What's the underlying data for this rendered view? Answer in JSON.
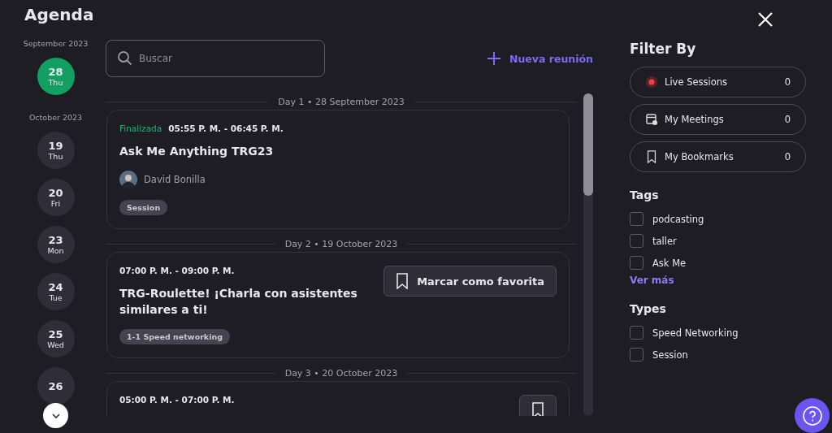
{
  "title": "Agenda",
  "dates": [
    {
      "month": "September 2023",
      "days": [
        {
          "num": "28",
          "dow": "Thu",
          "selected": true
        }
      ]
    },
    {
      "month": "October 2023",
      "days": [
        {
          "num": "19",
          "dow": "Thu",
          "selected": false
        },
        {
          "num": "20",
          "dow": "Fri",
          "selected": false
        },
        {
          "num": "23",
          "dow": "Mon",
          "selected": false
        },
        {
          "num": "24",
          "dow": "Tue",
          "selected": false
        },
        {
          "num": "25",
          "dow": "Wed",
          "selected": false
        },
        {
          "num": "26",
          "selected": false
        }
      ]
    }
  ],
  "search": {
    "placeholder": "Buscar"
  },
  "new_meeting": {
    "label": "Nueva reunión"
  },
  "days": [
    {
      "label": "Day 1 • 28 September 2023",
      "sessions": [
        {
          "status": "Finalizada",
          "time": "05:55 P. M. - 06:45 P. M.",
          "title": "Ask Me Anything TRG23",
          "speaker": "David Bonilla",
          "tag": "Session",
          "bookmark": false
        }
      ]
    },
    {
      "label": "Day 2 • 19 October 2023",
      "sessions": [
        {
          "time": "07:00 P. M. - 09:00 P. M.",
          "title": "TRG-Roulette! ¡Charla con asistentes similares a ti!",
          "tag": "1-1 Speed networking",
          "bookmark": true,
          "bookmark_label": "Marcar como favorita"
        }
      ]
    },
    {
      "label": "Day 3 • 20 October 2023",
      "sessions": [
        {
          "time": "05:00 P. M. - 07:00 P. M.",
          "bookmark": true
        }
      ]
    }
  ],
  "filter": {
    "title": "Filter By",
    "items": [
      {
        "kind": "live",
        "label": "Live Sessions",
        "count": "0"
      },
      {
        "kind": "meetings",
        "label": "My Meetings",
        "count": "0"
      },
      {
        "kind": "bookmarks",
        "label": "My Bookmarks",
        "count": "0"
      }
    ]
  },
  "tags": {
    "title": "Tags",
    "items": [
      {
        "label": "podcasting",
        "checked": false
      },
      {
        "label": "taller",
        "checked": false
      },
      {
        "label": "Ask Me",
        "checked": false
      }
    ],
    "more": "Ver más"
  },
  "types": {
    "title": "Types",
    "items": [
      {
        "label": "Speed Networking",
        "checked": false
      },
      {
        "label": "Session",
        "checked": false
      }
    ]
  }
}
